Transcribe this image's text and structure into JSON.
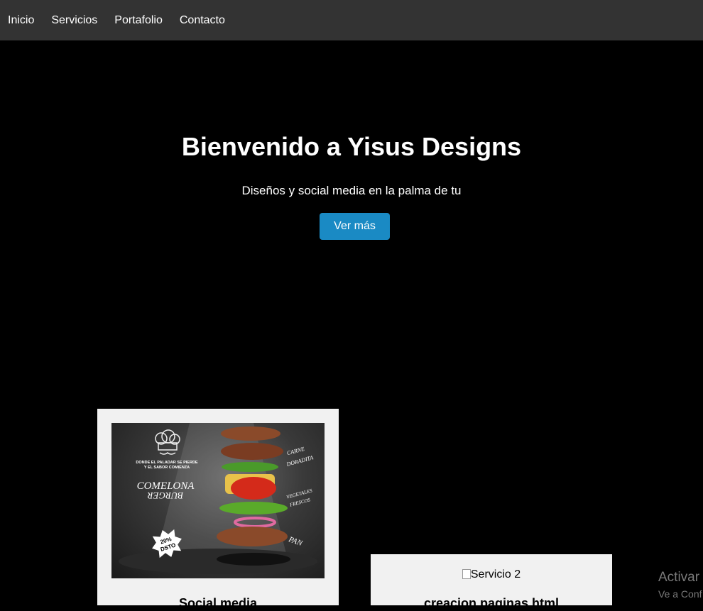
{
  "nav": {
    "items": [
      "Inicio",
      "Servicios",
      "Portafolio",
      "Contacto"
    ]
  },
  "hero": {
    "title": "Bienvenido a Yisus Designs",
    "subtitle": "Diseños y social media en la palma de tu",
    "button": "Ver más"
  },
  "cards": [
    {
      "title": "Social media",
      "image_text": {
        "tagline": "DONDE EL PALADAR SE PIERDE Y EL SABOR COMIENZA",
        "brand_line1": "COMELONA",
        "brand_line2": "BURGER",
        "discount": "20% DSTO",
        "label1": "CARNE DORADITA",
        "label2": "VEGETALES FRESCOS",
        "label3": "PAN"
      }
    },
    {
      "title": "creacion paginas html",
      "image_alt": "Servicio 2"
    }
  ],
  "watermark": {
    "line1": "Activar",
    "line2": "Ve a Conf"
  },
  "colors": {
    "navbar": "#333333",
    "background": "#000000",
    "button": "#1a8ac4",
    "card": "#f1f1f1"
  }
}
